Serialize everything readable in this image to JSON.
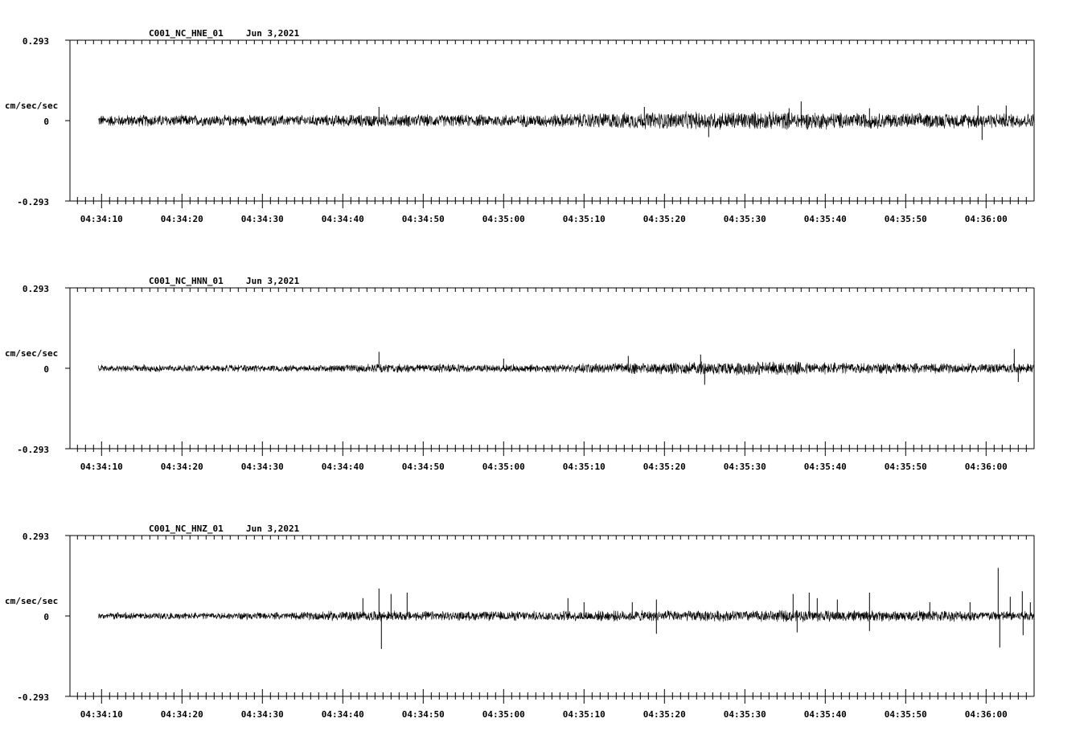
{
  "chart_data": [
    {
      "type": "line",
      "channel": "C001_NC_HNE_01",
      "date": "Jun 3,2021",
      "ylabel": "cm/sec/sec",
      "ylim": [
        -0.293,
        0.293
      ],
      "y_ticks": [
        "0.293",
        "0",
        "-0.293"
      ],
      "x_ticks": [
        "04:34:10",
        "04:34:20",
        "04:34:30",
        "04:34:40",
        "04:34:50",
        "04:35:00",
        "04:35:10",
        "04:35:20",
        "04:35:30",
        "04:35:40",
        "04:35:50",
        "04:36:00"
      ],
      "x_range_sec": [
        8,
        126
      ],
      "noise_envelope": [
        [
          8,
          0.022
        ],
        [
          15,
          0.024
        ],
        [
          25,
          0.022
        ],
        [
          35,
          0.022
        ],
        [
          45,
          0.026
        ],
        [
          55,
          0.024
        ],
        [
          65,
          0.026
        ],
        [
          72,
          0.032
        ],
        [
          78,
          0.034
        ],
        [
          86,
          0.036
        ],
        [
          93,
          0.036
        ],
        [
          100,
          0.034
        ],
        [
          110,
          0.03
        ],
        [
          118,
          0.03
        ],
        [
          126,
          0.03
        ]
      ],
      "spikes": [
        [
          44.5,
          0.05
        ],
        [
          77.5,
          0.05
        ],
        [
          85.5,
          -0.06
        ],
        [
          95.5,
          0.045
        ],
        [
          97,
          0.07
        ],
        [
          105.5,
          0.045
        ],
        [
          119,
          0.055
        ],
        [
          119.5,
          -0.07
        ],
        [
          122.5,
          0.055
        ]
      ]
    },
    {
      "type": "line",
      "channel": "C001_NC_HNN_01",
      "date": "Jun 3,2021",
      "ylabel": "cm/sec/sec",
      "ylim": [
        -0.293,
        0.293
      ],
      "y_ticks": [
        "0.293",
        "0",
        "-0.293"
      ],
      "x_ticks": [
        "04:34:10",
        "04:34:20",
        "04:34:30",
        "04:34:40",
        "04:34:50",
        "04:35:00",
        "04:35:10",
        "04:35:20",
        "04:35:30",
        "04:35:40",
        "04:35:50",
        "04:36:00"
      ],
      "x_range_sec": [
        8,
        126
      ],
      "noise_envelope": [
        [
          8,
          0.014
        ],
        [
          20,
          0.014
        ],
        [
          35,
          0.014
        ],
        [
          45,
          0.018
        ],
        [
          55,
          0.016
        ],
        [
          66,
          0.016
        ],
        [
          72,
          0.02
        ],
        [
          80,
          0.024
        ],
        [
          86,
          0.028
        ],
        [
          93,
          0.028
        ],
        [
          102,
          0.024
        ],
        [
          110,
          0.02
        ],
        [
          126,
          0.02
        ]
      ],
      "spikes": [
        [
          44.5,
          0.06
        ],
        [
          60,
          0.035
        ],
        [
          75.5,
          0.045
        ],
        [
          84.5,
          0.05
        ],
        [
          85,
          -0.06
        ],
        [
          123.5,
          0.07
        ],
        [
          124,
          -0.05
        ]
      ]
    },
    {
      "type": "line",
      "channel": "C001_NC_HNZ_01",
      "date": "Jun 3,2021",
      "ylabel": "cm/sec/sec",
      "ylim": [
        -0.293,
        0.293
      ],
      "y_ticks": [
        "0.293",
        "0",
        "-0.293"
      ],
      "x_ticks": [
        "04:34:10",
        "04:34:20",
        "04:34:30",
        "04:34:40",
        "04:34:50",
        "04:35:00",
        "04:35:10",
        "04:35:20",
        "04:35:30",
        "04:35:40",
        "04:35:50",
        "04:36:00"
      ],
      "x_range_sec": [
        8,
        126
      ],
      "noise_envelope": [
        [
          8,
          0.014
        ],
        [
          25,
          0.014
        ],
        [
          33,
          0.014
        ],
        [
          38,
          0.02
        ],
        [
          46,
          0.02
        ],
        [
          55,
          0.018
        ],
        [
          66,
          0.02
        ],
        [
          80,
          0.022
        ],
        [
          88,
          0.022
        ],
        [
          95,
          0.024
        ],
        [
          104,
          0.022
        ],
        [
          115,
          0.022
        ],
        [
          126,
          0.02
        ]
      ],
      "spikes": [
        [
          42.5,
          0.065
        ],
        [
          44.5,
          0.1
        ],
        [
          44.8,
          -0.12
        ],
        [
          46,
          0.08
        ],
        [
          48,
          0.085
        ],
        [
          68,
          0.065
        ],
        [
          70,
          0.05
        ],
        [
          76,
          0.05
        ],
        [
          79,
          0.06
        ],
        [
          79,
          -0.065
        ],
        [
          96,
          0.08
        ],
        [
          96.5,
          -0.06
        ],
        [
          98,
          0.085
        ],
        [
          99,
          0.065
        ],
        [
          101.5,
          0.06
        ],
        [
          105.5,
          0.085
        ],
        [
          105.5,
          -0.055
        ],
        [
          113,
          0.05
        ],
        [
          118,
          0.05
        ],
        [
          121.5,
          0.175
        ],
        [
          121.7,
          -0.115
        ],
        [
          123,
          0.07
        ],
        [
          124.5,
          0.09
        ],
        [
          124.6,
          -0.07
        ],
        [
          125.5,
          0.05
        ]
      ]
    }
  ]
}
